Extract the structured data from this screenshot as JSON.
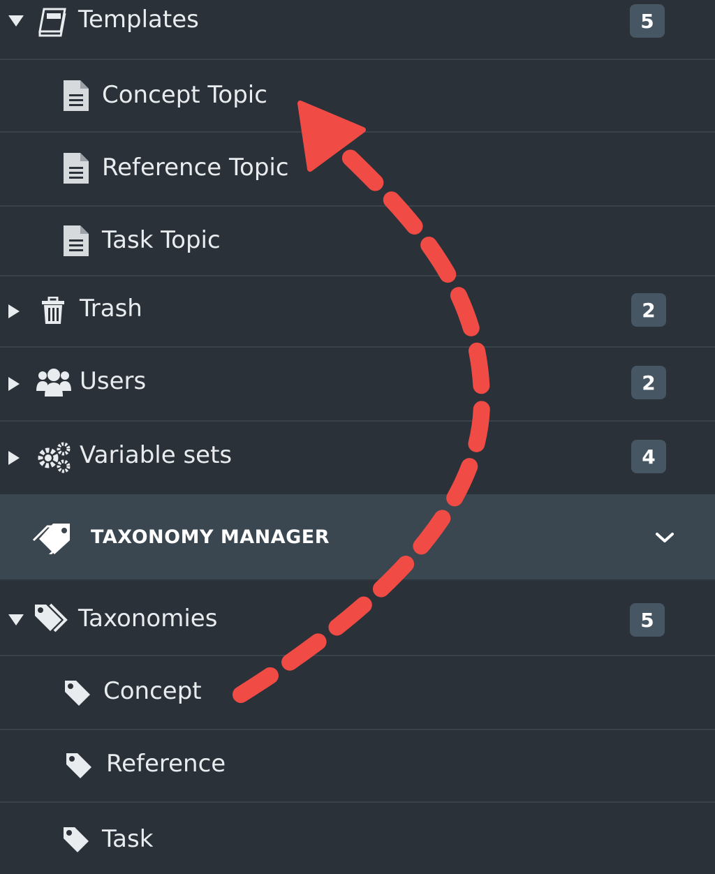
{
  "tree": {
    "templates": {
      "label": "Templates",
      "count": "5",
      "children": [
        "Concept Topic",
        "Reference Topic",
        "Task Topic"
      ]
    },
    "trash": {
      "label": "Trash",
      "count": "2"
    },
    "users": {
      "label": "Users",
      "count": "2"
    },
    "variable_sets": {
      "label": "Variable sets",
      "count": "4"
    }
  },
  "taxonomy_manager": {
    "label": "TAXONOMY MANAGER",
    "taxonomies": {
      "label": "Taxonomies",
      "count": "5",
      "children": [
        "Concept",
        "Reference",
        "Task"
      ]
    }
  },
  "colors": {
    "background": "#2b3138",
    "header_background": "#3a4650",
    "badge_background": "#475663",
    "annotation_arrow": "#f04c45"
  },
  "icons": {
    "templates": "book-icon",
    "template_item": "document-icon",
    "trash": "trash-icon",
    "users": "users-icon",
    "variable_sets": "gears-icon",
    "taxonomy_manager": "tags-icon",
    "taxonomies": "tags-icon",
    "taxonomy_item": "tag-icon"
  }
}
